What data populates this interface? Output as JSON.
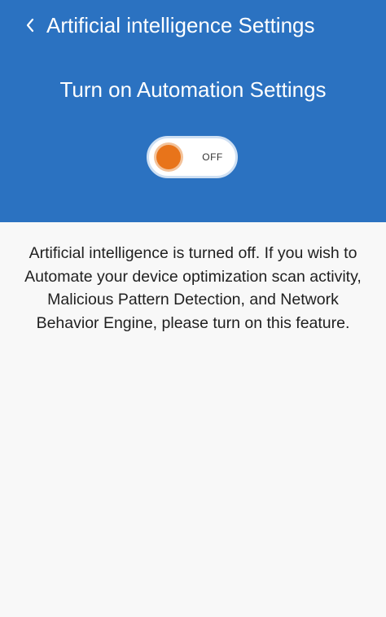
{
  "header": {
    "back_icon": "chevron-left-icon",
    "title": "Artificial intelligence Settings",
    "background_color": "#2b72c1"
  },
  "automation": {
    "section_title": "Turn on Automation Settings",
    "toggle": {
      "state_label": "OFF",
      "is_on": false,
      "knob_color": "#e8741a"
    }
  },
  "content": {
    "message": "Artificial intelligence is turned off. If you wish to Automate your device optimization scan activity, Malicious Pattern Detection, and Network Behavior Engine, please turn on this feature."
  }
}
